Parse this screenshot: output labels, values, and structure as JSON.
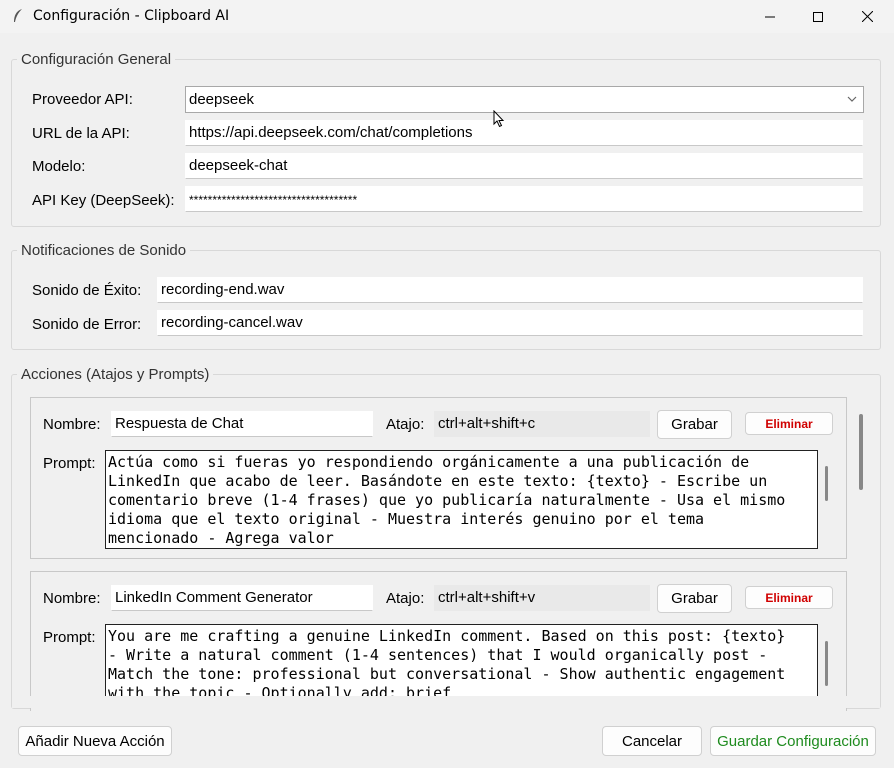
{
  "window": {
    "title": "Configuración - Clipboard AI"
  },
  "general": {
    "group_label": "Configuración General",
    "provider_label": "Proveedor API:",
    "provider_value": "deepseek",
    "url_label": "URL de la API:",
    "url_value": "https://api.deepseek.com/chat/completions",
    "model_label": "Modelo:",
    "model_value": "deepseek-chat",
    "key_label": "API Key (DeepSeek):",
    "key_value": "************************************"
  },
  "sound": {
    "group_label": "Notificaciones de Sonido",
    "success_label": "Sonido de Éxito:",
    "success_value": "recording-end.wav",
    "error_label": "Sonido de Error:",
    "error_value": "recording-cancel.wav"
  },
  "actions": {
    "group_label": "Acciones (Atajos y Prompts)",
    "name_label": "Nombre:",
    "shortcut_label": "Atajo:",
    "prompt_label": "Prompt:",
    "record_label": "Grabar",
    "delete_label": "Eliminar",
    "items": [
      {
        "name": "Respuesta de Chat",
        "shortcut": "ctrl+alt+shift+c",
        "prompt": "Actúa como si fueras yo respondiendo orgánicamente a una publicación de LinkedIn que acabo de leer. Basándote en este texto: {texto} - Escribe un comentario breve (1-4 frases) que yo publicaría naturalmente - Usa el mismo idioma que el texto original - Muestra interés genuino por el tema mencionado - Agrega valor"
      },
      {
        "name": "LinkedIn Comment Generator",
        "shortcut": "ctrl+alt+shift+v",
        "prompt": "You are me crafting a genuine LinkedIn comment. Based on this post: {texto} - Write a natural comment (1-4 sentences) that I would organically post - Match the tone: professional but conversational - Show authentic engagement with the topic - Optionally add: brief"
      }
    ]
  },
  "footer": {
    "add_label": "Añadir Nueva Acción",
    "cancel_label": "Cancelar",
    "save_label": "Guardar Configuración"
  },
  "colors": {
    "delete": "#d00000",
    "save": "#1e8b1e"
  }
}
